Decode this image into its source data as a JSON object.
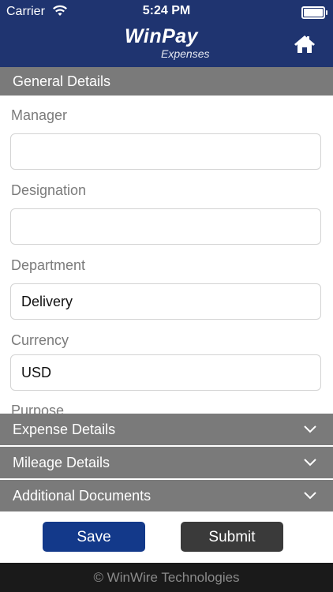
{
  "status_bar": {
    "carrier": "Carrier",
    "time": "5:24 PM"
  },
  "header": {
    "logo_name": "WinPay",
    "logo_sub": "Expenses"
  },
  "general_details": {
    "title": "General Details"
  },
  "form": {
    "manager": {
      "label": "Manager",
      "value": ""
    },
    "designation": {
      "label": "Designation",
      "value": ""
    },
    "department": {
      "label": "Department",
      "value": "Delivery"
    },
    "currency": {
      "label": "Currency",
      "value": "USD"
    },
    "purpose": {
      "label": "Purpose"
    }
  },
  "sections": {
    "expense": "Expense Details",
    "mileage": "Mileage Details",
    "documents": "Additional Documents"
  },
  "actions": {
    "save": "Save",
    "submit": "Submit"
  },
  "footer": {
    "copyright": "© WinWire Technologies"
  },
  "colors": {
    "header": "#1f3470",
    "section": "#7a7a7a",
    "save": "#13398a",
    "submit": "#3a3a3a"
  }
}
